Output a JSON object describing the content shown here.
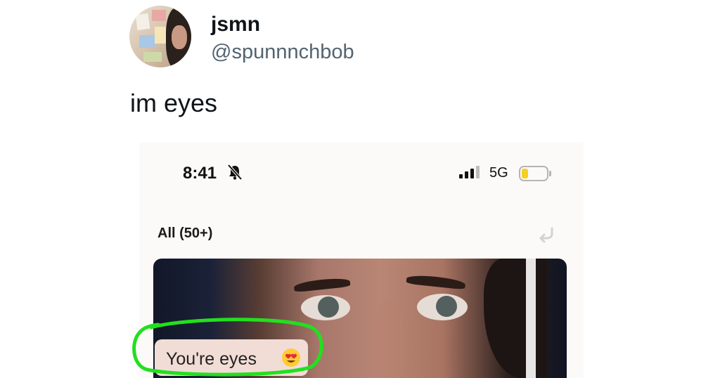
{
  "tweet": {
    "display_name": "jsmn",
    "handle": "@spunnnchbob",
    "text": "im eyes"
  },
  "screenshot": {
    "status_bar": {
      "time": "8:41",
      "network": "5G",
      "icons": [
        "bell-slash-icon",
        "signal-bars-icon",
        "battery-icon"
      ]
    },
    "filter_label": "All (50+)",
    "undo_icon": "undo-icon",
    "comment": {
      "text": "You're eyes",
      "emoji_icon": "heart-eyes-emoji-icon"
    }
  },
  "colors": {
    "highlight_stroke": "#22e01e",
    "handle": "#536471",
    "battery_fill": "#f5d020",
    "comment_bubble": "#f1ddd6"
  }
}
